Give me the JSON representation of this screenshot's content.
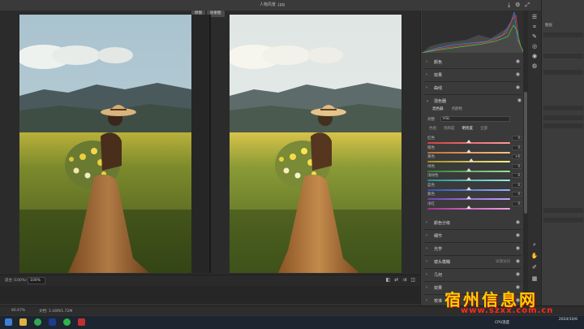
{
  "window": {
    "title": "人物风景 .jpg",
    "compare_before": "原图",
    "compare_after": "效果图"
  },
  "bottom": {
    "zoom_label": "适合 (100%)",
    "zoom_value": "100%",
    "status_zoom": "66.67%",
    "status_doc": "文档: 1.44M/1.72M"
  },
  "panel": {
    "sections_top": [
      "颜色",
      "效果",
      "曲线"
    ],
    "mixer": {
      "title": "混色器",
      "modes": [
        "混色器",
        "点颜色"
      ],
      "adjust_label": "调整",
      "adjust_value": "HSL",
      "tabs": [
        "色相",
        "饱和度",
        "明亮度",
        "全部"
      ],
      "active_tab": "明亮度",
      "sliders": [
        {
          "name": "红色",
          "value": "0",
          "pos": 0.5,
          "color_from": "#d04040",
          "color_to": "#ff9a9a"
        },
        {
          "name": "橙色",
          "value": "0",
          "pos": 0.5,
          "color_from": "#c07030",
          "color_to": "#ffc08a"
        },
        {
          "name": "黄色",
          "value": "+6",
          "pos": 0.53,
          "color_from": "#a09020",
          "color_to": "#fff08a"
        },
        {
          "name": "绿色",
          "value": "0",
          "pos": 0.5,
          "color_from": "#308030",
          "color_to": "#9ae09a"
        },
        {
          "name": "浅绿色",
          "value": "0",
          "pos": 0.5,
          "color_from": "#209090",
          "color_to": "#9ae8e8"
        },
        {
          "name": "蓝色",
          "value": "0",
          "pos": 0.5,
          "color_from": "#3050b0",
          "color_to": "#9ab0ff"
        },
        {
          "name": "紫色",
          "value": "0",
          "pos": 0.5,
          "color_from": "#7040b0",
          "color_to": "#c8a0ff"
        },
        {
          "name": "洋红",
          "value": "0",
          "pos": 0.5,
          "color_from": "#a03090",
          "color_to": "#f0a0e8"
        }
      ]
    },
    "sections_bottom": [
      "颜色分级",
      "细节",
      "光学",
      "镜头模糊",
      "几何",
      "效果",
      "校准"
    ],
    "lens_blur_extra": "早期访问"
  },
  "watermark": {
    "cn": "宿州信息网",
    "url": "www.szxx.com.cn"
  },
  "taskbar": {
    "cpu": "CPU温度",
    "time": "",
    "date": "2024/10/6"
  },
  "colors": {
    "accent_yellow": "#f5d300",
    "accent_red": "#ff2a1a"
  }
}
